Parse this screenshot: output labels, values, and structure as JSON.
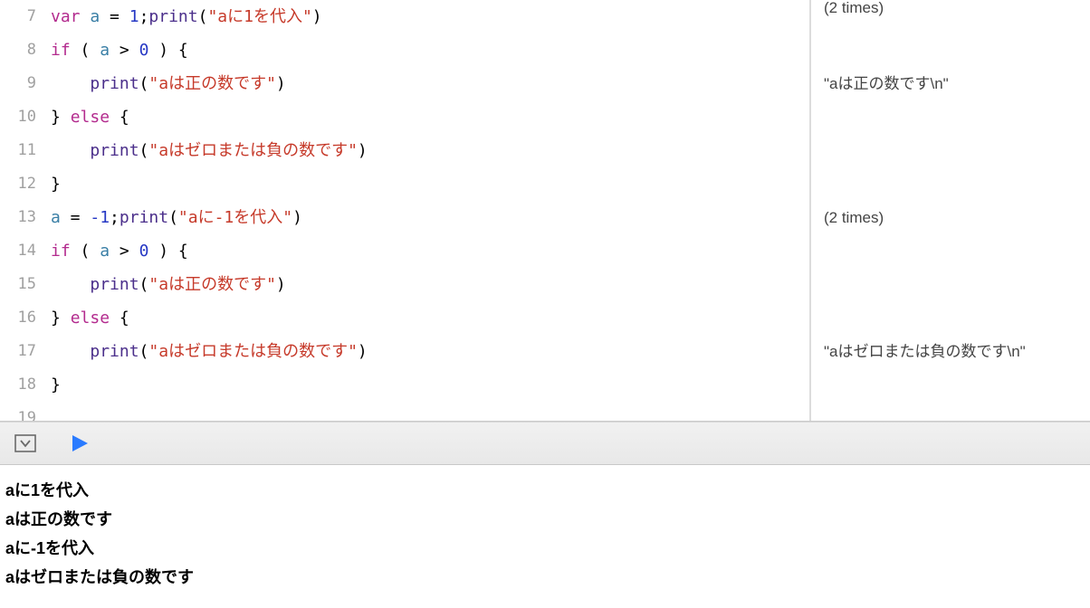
{
  "gutter": {
    "start": 7,
    "end": 19
  },
  "code": {
    "l7": {
      "kw": "var",
      "v": "a",
      "eq": " = ",
      "n": "1",
      "semi": ";",
      "fn": "print",
      "lp": "(",
      "s": "\"aに1を代入\"",
      "rp": ")"
    },
    "l8": {
      "kw": "if",
      "lp": " ( ",
      "v": "a",
      "op": " > ",
      "n": "0",
      "rp": " ) {",
      "pre": ""
    },
    "l9": {
      "pre": "    ",
      "fn": "print",
      "lp": "(",
      "s": "\"aは正の数です\"",
      "rp": ")"
    },
    "l10": {
      "rb": "} ",
      "kw": "else",
      "lb": " {"
    },
    "l11": {
      "pre": "    ",
      "fn": "print",
      "lp": "(",
      "s": "\"aはゼロまたは負の数です\"",
      "rp": ")"
    },
    "l12": {
      "rb": "}"
    },
    "l13": {
      "v": "a",
      "eq": " = ",
      "n": "-1",
      "semi": ";",
      "fn": "print",
      "lp": "(",
      "s": "\"aに-1を代入\"",
      "rp": ")"
    },
    "l14": {
      "kw": "if",
      "lp": " ( ",
      "v": "a",
      "op": " > ",
      "n": "0",
      "rp": " ) {"
    },
    "l15": {
      "pre": "    ",
      "fn": "print",
      "lp": "(",
      "s": "\"aは正の数です\"",
      "rp": ")"
    },
    "l16": {
      "rb": "} ",
      "kw": "else",
      "lb": " {"
    },
    "l17": {
      "pre": "    ",
      "fn": "print",
      "lp": "(",
      "s": "\"aはゼロまたは負の数です\"",
      "rp": ")"
    },
    "l18": {
      "rb": "}"
    },
    "l19": {
      "blank": ""
    }
  },
  "results": {
    "r7": "(2 times)",
    "r9": "\"aは正の数です\\n\"",
    "r13": "(2 times)",
    "r17": "\"aはゼロまたは負の数です\\n\""
  },
  "console": {
    "l1": "aに1を代入",
    "l2": "aは正の数です",
    "l3": "aに-1を代入",
    "l4": "aはゼロまたは負の数です"
  }
}
